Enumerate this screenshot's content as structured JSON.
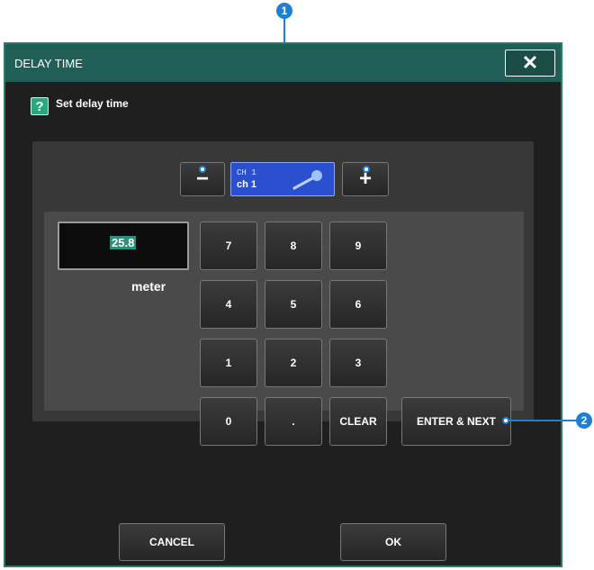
{
  "callouts": [
    "1",
    "2"
  ],
  "dialog": {
    "title": "DELAY TIME",
    "help_text": "Set delay time",
    "help_icon": "?"
  },
  "channel": {
    "number": "CH 1",
    "name": "ch 1"
  },
  "value": {
    "display": "25.8",
    "unit": "meter"
  },
  "keypad": {
    "k7": "7",
    "k8": "8",
    "k9": "9",
    "k4": "4",
    "k5": "5",
    "k6": "6",
    "k1": "1",
    "k2": "2",
    "k3": "3",
    "k0": "0",
    "dot": ".",
    "clear": "CLEAR",
    "enter_next": "ENTER & NEXT"
  },
  "footer": {
    "cancel": "CANCEL",
    "ok": "OK"
  },
  "colors": {
    "callout": "#1f7fd6",
    "title_bar": "#1f5f57",
    "channel_button": "#2a4fcf",
    "value_highlight": "#2d8f7a"
  }
}
